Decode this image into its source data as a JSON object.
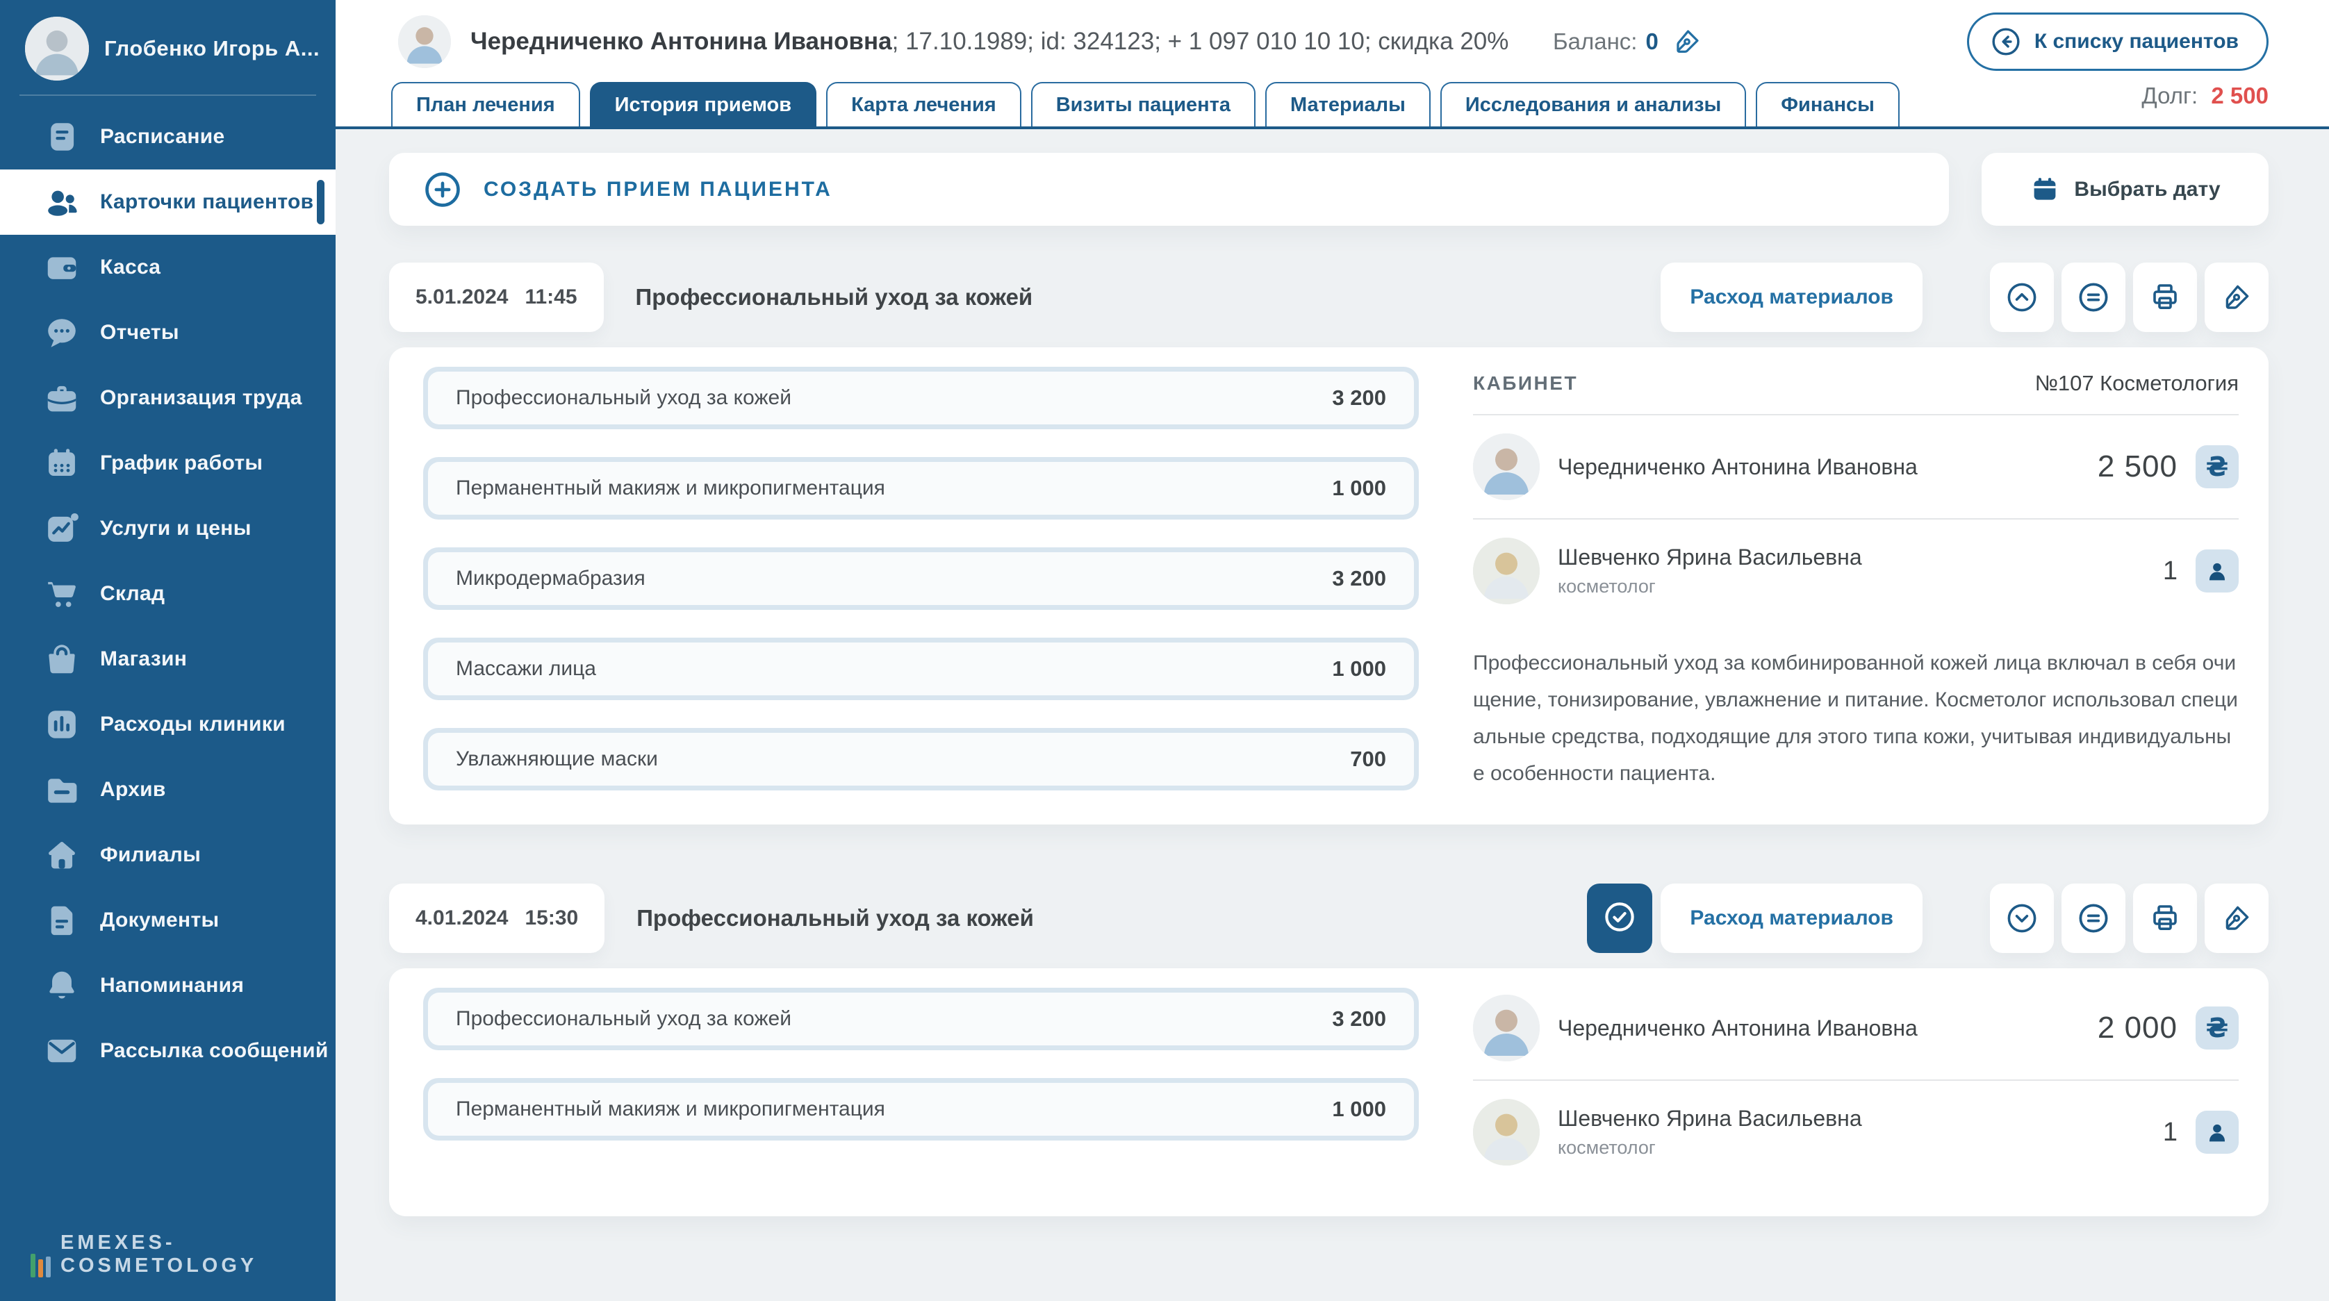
{
  "colors": {
    "sidebar_bg": "#1c5a89",
    "accent_blue": "#1d5a88",
    "link_blue": "#2470a4",
    "debt_red": "#e0504e",
    "content_bg": "#eef1f3",
    "service_row_border": "#d8e5ef",
    "badge_bg": "#d3e2ee"
  },
  "sidebar": {
    "user": {
      "name": "Глобенко Игорь А..."
    },
    "items": [
      {
        "label": "Расписание"
      },
      {
        "label": "Карточки пациентов",
        "active": true
      },
      {
        "label": "Касса"
      },
      {
        "label": "Отчеты"
      },
      {
        "label": "Организация труда"
      },
      {
        "label": "График работы"
      },
      {
        "label": "Услуги и цены"
      },
      {
        "label": "Склад"
      },
      {
        "label": "Магазин"
      },
      {
        "label": "Расходы клиники"
      },
      {
        "label": "Архив"
      },
      {
        "label": "Филиалы"
      },
      {
        "label": "Документы"
      },
      {
        "label": "Напоминания"
      },
      {
        "label": "Рассылка сообщений"
      }
    ],
    "logo": "emexes-cosmetology"
  },
  "header": {
    "patient_name": "Чередниченко Антонина Ивановна",
    "patient_details": "; 17.10.1989; id: 324123; + 1 097 010 10 10; скидка 20%",
    "balance_label": "Баланс:",
    "balance_value": "0",
    "back_button": "К списку пациентов",
    "debt_label": "Долг:",
    "debt_value": "2 500"
  },
  "tabs": [
    {
      "label": "План лечения"
    },
    {
      "label": "История приемов",
      "active": true
    },
    {
      "label": "Карта лечения"
    },
    {
      "label": "Визиты пациента"
    },
    {
      "label": "Материалы"
    },
    {
      "label": "Исследования и анализы"
    },
    {
      "label": "Финансы"
    }
  ],
  "toolbar": {
    "create_appointment": "СОЗДАТЬ ПРИЕМ ПАЦИЕНТА",
    "pick_date": "Выбрать дату"
  },
  "appointments": [
    {
      "date": "5.01.2024",
      "time": "11:45",
      "title": "Профессиональный уход за кожей",
      "materials_link": "Расход материалов",
      "services": [
        {
          "name": "Профессиональный уход за кожей",
          "price": "3 200"
        },
        {
          "name": "Перманентный макияж и микропигментация",
          "price": "1 000"
        },
        {
          "name": "Микродермабразия",
          "price": "3 200"
        },
        {
          "name": "Массажи лица",
          "price": "1 000"
        },
        {
          "name": "Увлажняющие маски",
          "price": "700"
        }
      ],
      "cabinet_label": "КАБИНЕТ",
      "cabinet_value": "№107 Косметология",
      "patient": {
        "name": "Чередниченко Антонина Ивановна",
        "amount": "2 500",
        "currency": "₴"
      },
      "doctor": {
        "name": "Шевченко Ярина Васильевна",
        "role": "косметолог",
        "count": "1"
      },
      "description": "Профессиональный уход за комбинированной кожей лица включал в себя очищение, тонизирование, увлажнение и питание. Косметолог использовал специальные средства, подходящие для этого типа кожи, учитывая индивидуальные особенности пациента."
    },
    {
      "date": "4.01.2024",
      "time": "15:30",
      "title": "Профессиональный уход за кожей",
      "materials_link": "Расход материалов",
      "services": [
        {
          "name": "Профессиональный уход за кожей",
          "price": "3 200"
        },
        {
          "name": "Перманентный макияж и микропигментация",
          "price": "1 000"
        }
      ],
      "patient": {
        "name": "Чередниченко Антонина Ивановна",
        "amount": "2 000",
        "currency": "₴"
      },
      "doctor": {
        "name": "Шевченко Ярина Васильевна",
        "role": "косметолог",
        "count": "1"
      }
    }
  ]
}
